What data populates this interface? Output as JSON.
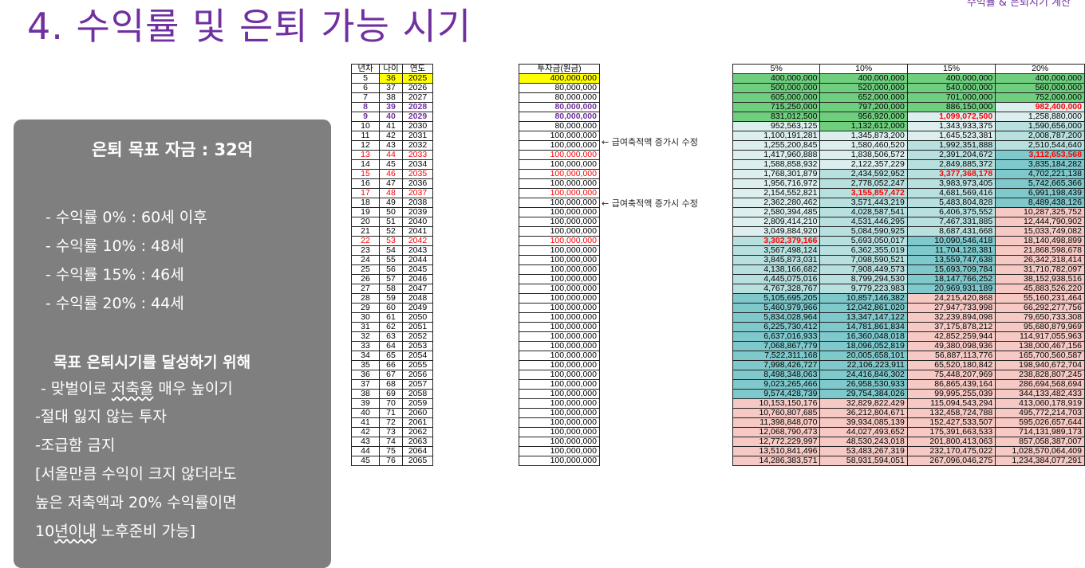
{
  "corner_label": "수익률 & 은퇴시기 계산",
  "title": "4. 수익률 및 은퇴 가능 시기",
  "panel": {
    "heading": "은퇴 목표 자금 : 32억",
    "rates": [
      "- 수익률   0% : 60세 이후",
      "- 수익률 10% : 48세",
      "- 수익률 15% : 46세",
      "- 수익률 20% : 44세"
    ],
    "subheading": "목표 은퇴시기를 달성하기 위해",
    "tips": {
      "t1_pre": "- 맞벌이로 ",
      "t1_ul": "저축율",
      "t1_post": " 매우 높이기",
      "t2": "-절대 잃지 않는 투자",
      "t3": "-조급함 금지",
      "t4": "[서울만큼 수익이 크지 않더라도",
      "t5": "높은 저축액과 20% 수익률이면",
      "t6_pre": "10",
      "t6_ul": "년이내",
      "t6_post": " 노후준비 가능]"
    }
  },
  "notes": [
    "← 급여축적액 증가시 수정",
    "← 급여축적액 증가시 수정"
  ],
  "table_left": {
    "headers": [
      "년차",
      "나이",
      "연도"
    ],
    "rows": [
      [
        "5",
        "36",
        "2025"
      ],
      [
        "6",
        "37",
        "2026"
      ],
      [
        "7",
        "38",
        "2027"
      ],
      [
        "8",
        "39",
        "2028"
      ],
      [
        "9",
        "40",
        "2029"
      ],
      [
        "10",
        "41",
        "2030"
      ],
      [
        "11",
        "42",
        "2031"
      ],
      [
        "12",
        "43",
        "2032"
      ],
      [
        "13",
        "44",
        "2033"
      ],
      [
        "14",
        "45",
        "2034"
      ],
      [
        "15",
        "46",
        "2035"
      ],
      [
        "16",
        "47",
        "2036"
      ],
      [
        "17",
        "48",
        "2037"
      ],
      [
        "18",
        "49",
        "2038"
      ],
      [
        "19",
        "50",
        "2039"
      ],
      [
        "20",
        "51",
        "2040"
      ],
      [
        "21",
        "52",
        "2041"
      ],
      [
        "22",
        "53",
        "2042"
      ],
      [
        "23",
        "54",
        "2043"
      ],
      [
        "24",
        "55",
        "2044"
      ],
      [
        "25",
        "56",
        "2045"
      ],
      [
        "26",
        "57",
        "2046"
      ],
      [
        "27",
        "58",
        "2047"
      ],
      [
        "28",
        "59",
        "2048"
      ],
      [
        "29",
        "60",
        "2049"
      ],
      [
        "30",
        "61",
        "2050"
      ],
      [
        "31",
        "62",
        "2051"
      ],
      [
        "32",
        "63",
        "2052"
      ],
      [
        "33",
        "64",
        "2053"
      ],
      [
        "34",
        "65",
        "2054"
      ],
      [
        "35",
        "66",
        "2055"
      ],
      [
        "36",
        "67",
        "2056"
      ],
      [
        "37",
        "68",
        "2057"
      ],
      [
        "38",
        "69",
        "2058"
      ],
      [
        "39",
        "70",
        "2059"
      ],
      [
        "40",
        "71",
        "2060"
      ],
      [
        "41",
        "72",
        "2061"
      ],
      [
        "42",
        "73",
        "2062"
      ],
      [
        "43",
        "74",
        "2063"
      ],
      [
        "44",
        "75",
        "2064"
      ],
      [
        "45",
        "76",
        "2065"
      ]
    ]
  },
  "table_invest": {
    "header": "투자금(원금)",
    "values": [
      "400,000,000",
      "80,000,000",
      "80,000,000",
      "80,000,000",
      "80,000,000",
      "80,000,000",
      "100,000,000",
      "100,000,000",
      "100,000,000",
      "100,000,000",
      "100,000,000",
      "100,000,000",
      "100,000,000",
      "100,000,000",
      "100,000,000",
      "100,000,000",
      "100,000,000",
      "100,000,000",
      "100,000,000",
      "100,000,000",
      "100,000,000",
      "100,000,000",
      "100,000,000",
      "100,000,000",
      "100,000,000",
      "100,000,000",
      "100,000,000",
      "100,000,000",
      "100,000,000",
      "100,000,000",
      "100,000,000",
      "100,000,000",
      "100,000,000",
      "100,000,000",
      "100,000,000",
      "100,000,000",
      "100,000,000",
      "100,000,000",
      "100,000,000",
      "100,000,000",
      "100,000,000"
    ]
  },
  "table_returns": {
    "headers": [
      "5%",
      "10%",
      "15%",
      "20%"
    ],
    "rows": [
      [
        "400,000,000",
        "400,000,000",
        "400,000,000",
        "400,000,000"
      ],
      [
        "500,000,000",
        "520,000,000",
        "540,000,000",
        "560,000,000"
      ],
      [
        "605,000,000",
        "652,000,000",
        "701,000,000",
        "752,000,000"
      ],
      [
        "715,250,000",
        "797,200,000",
        "886,150,000",
        "982,400,000"
      ],
      [
        "831,012,500",
        "956,920,000",
        "1,099,072,500",
        "1,258,880,000"
      ],
      [
        "952,563,125",
        "1,132,612,000",
        "1,343,933,375",
        "1,590,656,000"
      ],
      [
        "1,100,191,281",
        "1,345,873,200",
        "1,645,523,381",
        "2,008,787,200"
      ],
      [
        "1,255,200,845",
        "1,580,460,520",
        "1,992,351,888",
        "2,510,544,640"
      ],
      [
        "1,417,960,888",
        "1,838,506,572",
        "2,391,204,672",
        "3,112,653,568"
      ],
      [
        "1,588,858,932",
        "2,122,357,229",
        "2,849,885,372",
        "3,835,184,282"
      ],
      [
        "1,768,301,879",
        "2,434,592,952",
        "3,377,368,178",
        "4,702,221,138"
      ],
      [
        "1,956,716,972",
        "2,778,052,247",
        "3,983,973,405",
        "5,742,665,366"
      ],
      [
        "2,154,552,821",
        "3,155,857,472",
        "4,681,569,416",
        "6,991,198,439"
      ],
      [
        "2,362,280,462",
        "3,571,443,219",
        "5,483,804,828",
        "8,489,438,126"
      ],
      [
        "2,580,394,485",
        "4,028,587,541",
        "6,406,375,552",
        "10,287,325,752"
      ],
      [
        "2,809,414,210",
        "4,531,446,295",
        "7,467,331,885",
        "12,444,790,902"
      ],
      [
        "3,049,884,920",
        "5,084,590,925",
        "8,687,431,668",
        "15,033,749,082"
      ],
      [
        "3,302,379,166",
        "5,693,050,017",
        "10,090,546,418",
        "18,140,498,899"
      ],
      [
        "3,567,498,124",
        "6,362,355,019",
        "11,704,128,381",
        "21,868,598,678"
      ],
      [
        "3,845,873,031",
        "7,098,590,521",
        "13,559,747,638",
        "26,342,318,414"
      ],
      [
        "4,138,166,682",
        "7,908,449,573",
        "15,693,709,784",
        "31,710,782,097"
      ],
      [
        "4,445,075,016",
        "8,799,294,530",
        "18,147,766,252",
        "38,152,938,516"
      ],
      [
        "4,767,328,767",
        "9,779,223,983",
        "20,969,931,189",
        "45,883,526,220"
      ],
      [
        "5,105,695,205",
        "10,857,146,382",
        "24,215,420,868",
        "55,160,231,464"
      ],
      [
        "5,460,979,966",
        "12,042,861,020",
        "27,947,733,998",
        "66,292,277,756"
      ],
      [
        "5,834,028,964",
        "13,347,147,122",
        "32,239,894,098",
        "79,650,733,308"
      ],
      [
        "6,225,730,412",
        "14,781,861,834",
        "37,175,878,212",
        "95,680,879,969"
      ],
      [
        "6,637,016,933",
        "16,360,048,018",
        "42,852,259,944",
        "114,917,055,963"
      ],
      [
        "7,068,867,779",
        "18,096,052,819",
        "49,380,098,936",
        "138,000,467,156"
      ],
      [
        "7,522,311,168",
        "20,005,658,101",
        "56,887,113,776",
        "165,700,560,587"
      ],
      [
        "7,998,426,727",
        "22,106,223,911",
        "65,520,180,842",
        "198,940,672,704"
      ],
      [
        "8,498,348,063",
        "24,416,846,302",
        "75,448,207,969",
        "238,828,807,245"
      ],
      [
        "9,023,265,466",
        "26,958,530,933",
        "86,865,439,164",
        "286,694,568,694"
      ],
      [
        "9,574,428,739",
        "29,754,384,026",
        "99,995,255,039",
        "344,133,482,433"
      ],
      [
        "10,153,150,176",
        "32,829,822,429",
        "115,094,543,294",
        "413,060,178,919"
      ],
      [
        "10,760,807,685",
        "36,212,804,671",
        "132,458,724,788",
        "495,772,214,703"
      ],
      [
        "11,398,848,070",
        "39,934,085,139",
        "152,427,533,507",
        "595,026,657,644"
      ],
      [
        "12,068,790,473",
        "44,027,493,652",
        "175,391,663,533",
        "714,131,989,173"
      ],
      [
        "12,772,229,997",
        "48,530,243,018",
        "201,800,413,063",
        "857,058,387,007"
      ],
      [
        "13,510,841,496",
        "53,483,267,319",
        "232,170,475,022",
        "1,028,570,064,409"
      ],
      [
        "14,286,383,571",
        "58,931,594,051",
        "267,096,046,275",
        "1,234,384,077,291"
      ]
    ]
  },
  "colors": {
    "title": "#7030a0",
    "panel": "#7f7f7f",
    "highlight_yellow": "#ffff00",
    "green": "#6fcf7f",
    "light_green": "#a9dfb0",
    "pale_teal": "#dcefee",
    "light_teal": "#b7e0df",
    "teal": "#7fc8cc",
    "pink": "#f6c9c4",
    "red_text": "#ff0000",
    "purple_text": "#7030a0"
  }
}
